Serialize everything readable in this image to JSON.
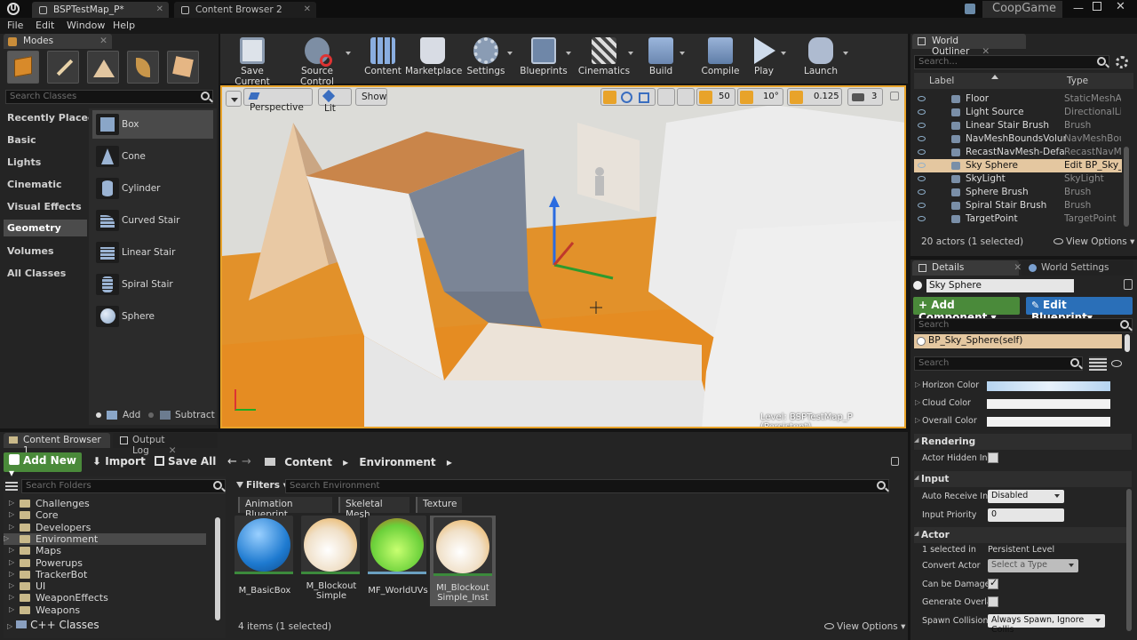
{
  "title_tabs": [
    {
      "label": "BSPTestMap_P*"
    },
    {
      "label": "Content Browser 2"
    }
  ],
  "project_name": "CoopGame",
  "menu": [
    "File",
    "Edit",
    "Window",
    "Help"
  ],
  "modes": {
    "title": "Modes",
    "search_placeholder": "Search Classes",
    "categories": [
      "Recently Placed",
      "Basic",
      "Lights",
      "Cinematic",
      "Visual Effects",
      "Geometry",
      "Volumes",
      "All Classes"
    ],
    "selected_category": "Geometry",
    "shapes": [
      "Box",
      "Cone",
      "Cylinder",
      "Curved Stair",
      "Linear Stair",
      "Spiral Stair",
      "Sphere"
    ],
    "add_label": "Add",
    "subtract_label": "Subtract"
  },
  "toolbar": {
    "buttons": [
      "Save Current",
      "Source Control",
      "Content",
      "Marketplace",
      "Settings",
      "Blueprints",
      "Cinematics",
      "Build",
      "Compile",
      "Play",
      "Launch"
    ]
  },
  "viewport": {
    "perspective": "Perspective",
    "lit": "Lit",
    "show": "Show",
    "grid_snap": "50",
    "rot_snap": "10°",
    "scale_snap": "0.125",
    "camera_speed": "3",
    "level_label": "Level:",
    "level_name": "BSPTestMap_P (Persistent)"
  },
  "outliner": {
    "title": "World Outliner",
    "search_placeholder": "Search...",
    "col_label": "Label",
    "col_type": "Type",
    "rows": [
      {
        "name": "Floor",
        "type": "StaticMeshAc"
      },
      {
        "name": "Light Source",
        "type": "DirectionalLig"
      },
      {
        "name": "Linear Stair Brush",
        "type": "Brush"
      },
      {
        "name": "NavMeshBoundsVolume",
        "type": "NavMeshBoun"
      },
      {
        "name": "RecastNavMesh-Default",
        "type": "RecastNavMe"
      },
      {
        "name": "Sky Sphere",
        "type": "Edit BP_Sky_"
      },
      {
        "name": "SkyLight",
        "type": "SkyLight"
      },
      {
        "name": "Sphere Brush",
        "type": "Brush"
      },
      {
        "name": "Spiral Stair Brush",
        "type": "Brush"
      },
      {
        "name": "TargetPoint",
        "type": "TargetPoint"
      }
    ],
    "selected_row": "Sky Sphere",
    "status": "20 actors (1 selected)",
    "view_options": "View Options"
  },
  "details": {
    "tab_details": "Details",
    "tab_world": "World Settings",
    "actor_name": "Sky Sphere",
    "add_component": "+ Add Component",
    "edit_blueprint": "Edit Blueprint",
    "search_placeholder": "Search",
    "component": "BP_Sky_Sphere(self)",
    "props_search": "Search",
    "colors": [
      {
        "label": "Horizon Color"
      },
      {
        "label": "Cloud Color"
      },
      {
        "label": "Overall Color"
      }
    ],
    "rendering": "Rendering",
    "actor_hidden": "Actor Hidden In G",
    "input": "Input",
    "auto_receive": "Auto Receive Inp",
    "auto_receive_val": "Disabled",
    "input_priority": "Input Priority",
    "input_priority_val": "0",
    "actor": "Actor",
    "selected_in": "1 selected in",
    "selected_in_val": "Persistent Level",
    "convert_actor": "Convert Actor",
    "convert_actor_val": "Select a Type",
    "can_be_damaged": "Can be Damaged",
    "generate_overlap": "Generate Overlap",
    "spawn_collision": "Spawn Collision I",
    "spawn_collision_val": "Always Spawn, Ignore Collis"
  },
  "content_browser": {
    "tab1": "Content Browser 1",
    "tab2": "Output Log",
    "add_new": "Add New",
    "import": "Import",
    "save_all": "Save All",
    "path": [
      "Content",
      "Environment"
    ],
    "search_folders": "Search Folders",
    "folders": [
      "Challenges",
      "Core",
      "Developers",
      "Environment",
      "Maps",
      "Powerups",
      "TrackerBot",
      "UI",
      "WeaponEffects",
      "Weapons"
    ],
    "selected_folder": "Environment",
    "cpp_classes": "C++ Classes",
    "filters": "Filters",
    "search_placeholder": "Search Environment",
    "filter_tags": [
      "Animation Blueprint",
      "Skeletal Mesh",
      "Texture"
    ],
    "assets": [
      {
        "line1": "M_BasicBox",
        "line2": ""
      },
      {
        "line1": "M_Blockout",
        "line2": "Simple"
      },
      {
        "line1": "MF_WorldUVs",
        "line2": ""
      },
      {
        "line1": "MI_Blockout",
        "line2": "Simple_Inst"
      }
    ],
    "status": "4 items (1 selected)",
    "view_options": "View Options"
  }
}
